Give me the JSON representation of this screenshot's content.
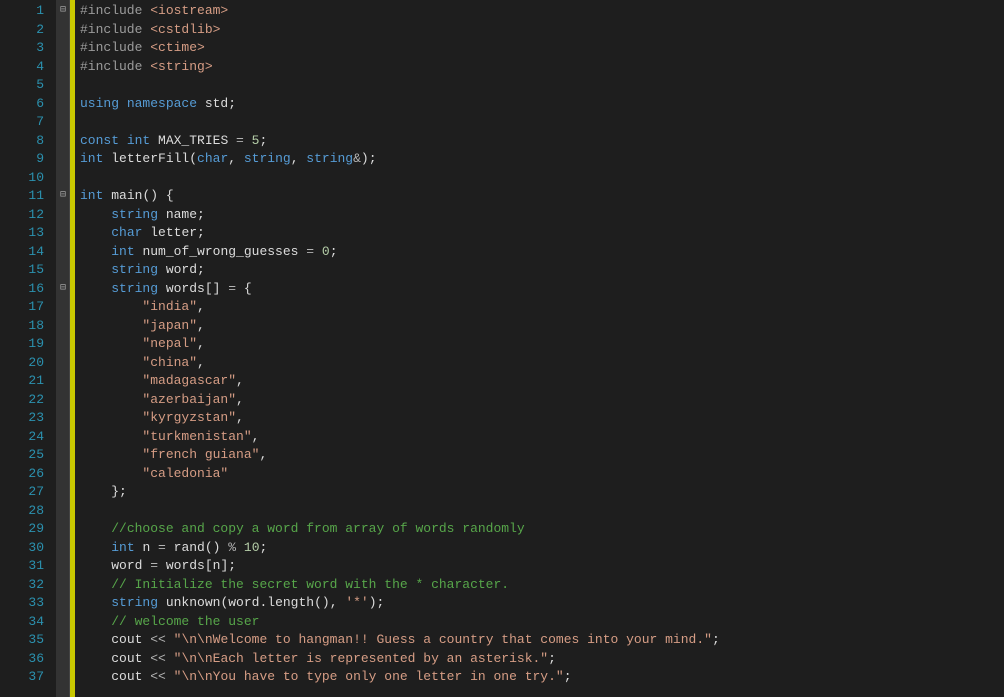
{
  "lines": [
    {
      "n": 1,
      "fold": "⊟",
      "tokens": [
        [
          "preproc",
          "#include "
        ],
        [
          "str",
          "<iostream>"
        ]
      ]
    },
    {
      "n": 2,
      "fold": "",
      "indent": 0,
      "tokens": [
        [
          "preproc",
          "#include "
        ],
        [
          "str",
          "<cstdlib>"
        ]
      ]
    },
    {
      "n": 3,
      "fold": "",
      "indent": 0,
      "tokens": [
        [
          "preproc",
          "#include "
        ],
        [
          "str",
          "<ctime>"
        ]
      ]
    },
    {
      "n": 4,
      "fold": "",
      "indent": 0,
      "tokens": [
        [
          "preproc",
          "#include "
        ],
        [
          "str",
          "<string>"
        ]
      ]
    },
    {
      "n": 5,
      "fold": "",
      "tokens": []
    },
    {
      "n": 6,
      "fold": "",
      "tokens": [
        [
          "kw",
          "using "
        ],
        [
          "kw",
          "namespace "
        ],
        [
          "ident",
          "std"
        ],
        [
          "punct",
          ";"
        ]
      ]
    },
    {
      "n": 7,
      "fold": "",
      "tokens": []
    },
    {
      "n": 8,
      "fold": "",
      "tokens": [
        [
          "kw",
          "const "
        ],
        [
          "kw",
          "int "
        ],
        [
          "ident",
          "MAX_TRIES "
        ],
        [
          "op",
          "= "
        ],
        [
          "num",
          "5"
        ],
        [
          "punct",
          ";"
        ]
      ]
    },
    {
      "n": 9,
      "fold": "",
      "tokens": [
        [
          "kw",
          "int "
        ],
        [
          "ident",
          "letterFill"
        ],
        [
          "punct",
          "("
        ],
        [
          "kw",
          "char"
        ],
        [
          "punct",
          ", "
        ],
        [
          "kw",
          "string"
        ],
        [
          "punct",
          ", "
        ],
        [
          "kw",
          "string"
        ],
        [
          "op",
          "&"
        ],
        [
          "punct",
          ");"
        ]
      ]
    },
    {
      "n": 10,
      "fold": "",
      "tokens": []
    },
    {
      "n": 11,
      "fold": "⊟",
      "tokens": [
        [
          "kw",
          "int "
        ],
        [
          "ident",
          "main"
        ],
        [
          "punct",
          "() {"
        ]
      ]
    },
    {
      "n": 12,
      "fold": "",
      "pad": "    ",
      "tokens": [
        [
          "kw",
          "string "
        ],
        [
          "ident",
          "name"
        ],
        [
          "punct",
          ";"
        ]
      ]
    },
    {
      "n": 13,
      "fold": "",
      "pad": "    ",
      "tokens": [
        [
          "kw",
          "char "
        ],
        [
          "ident",
          "letter"
        ],
        [
          "punct",
          ";"
        ]
      ]
    },
    {
      "n": 14,
      "fold": "",
      "pad": "    ",
      "tokens": [
        [
          "kw",
          "int "
        ],
        [
          "ident",
          "num_of_wrong_guesses "
        ],
        [
          "op",
          "= "
        ],
        [
          "num",
          "0"
        ],
        [
          "punct",
          ";"
        ]
      ]
    },
    {
      "n": 15,
      "fold": "",
      "pad": "    ",
      "tokens": [
        [
          "kw",
          "string "
        ],
        [
          "ident",
          "word"
        ],
        [
          "punct",
          ";"
        ]
      ]
    },
    {
      "n": 16,
      "fold": "⊟",
      "pad": "    ",
      "tokens": [
        [
          "kw",
          "string "
        ],
        [
          "ident",
          "words"
        ],
        [
          "punct",
          "[] "
        ],
        [
          "op",
          "= "
        ],
        [
          "punct",
          "{"
        ]
      ]
    },
    {
      "n": 17,
      "fold": "",
      "pad": "        ",
      "tokens": [
        [
          "str",
          "\"india\""
        ],
        [
          "punct",
          ","
        ]
      ]
    },
    {
      "n": 18,
      "fold": "",
      "pad": "        ",
      "tokens": [
        [
          "str",
          "\"japan\""
        ],
        [
          "punct",
          ","
        ]
      ]
    },
    {
      "n": 19,
      "fold": "",
      "pad": "        ",
      "tokens": [
        [
          "str",
          "\"nepal\""
        ],
        [
          "punct",
          ","
        ]
      ]
    },
    {
      "n": 20,
      "fold": "",
      "pad": "        ",
      "tokens": [
        [
          "str",
          "\"china\""
        ],
        [
          "punct",
          ","
        ]
      ]
    },
    {
      "n": 21,
      "fold": "",
      "pad": "        ",
      "tokens": [
        [
          "str",
          "\"madagascar\""
        ],
        [
          "punct",
          ","
        ]
      ]
    },
    {
      "n": 22,
      "fold": "",
      "pad": "        ",
      "tokens": [
        [
          "str",
          "\"azerbaijan\""
        ],
        [
          "punct",
          ","
        ]
      ]
    },
    {
      "n": 23,
      "fold": "",
      "pad": "        ",
      "tokens": [
        [
          "str",
          "\"kyrgyzstan\""
        ],
        [
          "punct",
          ","
        ]
      ]
    },
    {
      "n": 24,
      "fold": "",
      "pad": "        ",
      "tokens": [
        [
          "str",
          "\"turkmenistan\""
        ],
        [
          "punct",
          ","
        ]
      ]
    },
    {
      "n": 25,
      "fold": "",
      "pad": "        ",
      "tokens": [
        [
          "str",
          "\"french guiana\""
        ],
        [
          "punct",
          ","
        ]
      ]
    },
    {
      "n": 26,
      "fold": "",
      "pad": "        ",
      "tokens": [
        [
          "str",
          "\"caledonia\""
        ]
      ]
    },
    {
      "n": 27,
      "fold": "",
      "pad": "    ",
      "tokens": [
        [
          "punct",
          "};"
        ]
      ]
    },
    {
      "n": 28,
      "fold": "",
      "tokens": []
    },
    {
      "n": 29,
      "fold": "",
      "pad": "    ",
      "tokens": [
        [
          "cmt",
          "//choose and copy a word from array of words randomly"
        ]
      ]
    },
    {
      "n": 30,
      "fold": "",
      "pad": "    ",
      "tokens": [
        [
          "kw",
          "int "
        ],
        [
          "ident",
          "n "
        ],
        [
          "op",
          "= "
        ],
        [
          "ident",
          "rand"
        ],
        [
          "punct",
          "() "
        ],
        [
          "op",
          "% "
        ],
        [
          "num",
          "10"
        ],
        [
          "punct",
          ";"
        ]
      ]
    },
    {
      "n": 31,
      "fold": "",
      "pad": "    ",
      "tokens": [
        [
          "ident",
          "word "
        ],
        [
          "op",
          "= "
        ],
        [
          "ident",
          "words"
        ],
        [
          "punct",
          "["
        ],
        [
          "ident",
          "n"
        ],
        [
          "punct",
          "];"
        ]
      ]
    },
    {
      "n": 32,
      "fold": "",
      "pad": "    ",
      "tokens": [
        [
          "cmt",
          "// Initialize the secret word with the * character."
        ]
      ]
    },
    {
      "n": 33,
      "fold": "",
      "pad": "    ",
      "tokens": [
        [
          "kw",
          "string "
        ],
        [
          "ident",
          "unknown"
        ],
        [
          "punct",
          "("
        ],
        [
          "ident",
          "word"
        ],
        [
          "punct",
          "."
        ],
        [
          "ident",
          "length"
        ],
        [
          "punct",
          "(), "
        ],
        [
          "str",
          "'*'"
        ],
        [
          "punct",
          ");"
        ]
      ]
    },
    {
      "n": 34,
      "fold": "",
      "pad": "    ",
      "tokens": [
        [
          "cmt",
          "// welcome the user"
        ]
      ]
    },
    {
      "n": 35,
      "fold": "",
      "pad": "    ",
      "tokens": [
        [
          "ident",
          "cout "
        ],
        [
          "op",
          "<< "
        ],
        [
          "str",
          "\"\\n\\nWelcome to hangman!! Guess a country that comes into your mind.\""
        ],
        [
          "punct",
          ";"
        ]
      ]
    },
    {
      "n": 36,
      "fold": "",
      "pad": "    ",
      "tokens": [
        [
          "ident",
          "cout "
        ],
        [
          "op",
          "<< "
        ],
        [
          "str",
          "\"\\n\\nEach letter is represented by an asterisk.\""
        ],
        [
          "punct",
          ";"
        ]
      ]
    },
    {
      "n": 37,
      "fold": "",
      "pad": "    ",
      "tokens": [
        [
          "ident",
          "cout "
        ],
        [
          "op",
          "<< "
        ],
        [
          "str",
          "\"\\n\\nYou have to type only one letter in one try.\""
        ],
        [
          "punct",
          ";"
        ]
      ]
    }
  ]
}
